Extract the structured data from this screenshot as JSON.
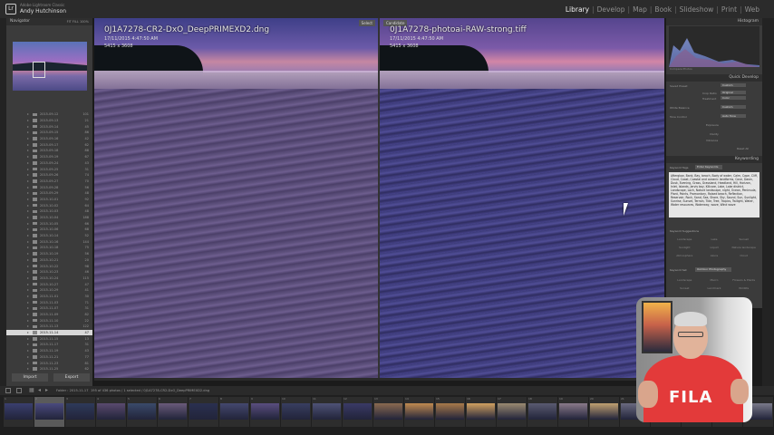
{
  "identity": {
    "sub": "Adobe Lightroom Classic",
    "name": "Andy Hutchinson"
  },
  "modules": [
    "Library",
    "Develop",
    "Map",
    "Book",
    "Slideshow",
    "Print",
    "Web"
  ],
  "active_module": "Library",
  "navigator": {
    "title": "Navigator",
    "zoom": "FIT   FILL   100%"
  },
  "folders": [
    {
      "name": "2015-09-12",
      "count": "101"
    },
    {
      "name": "2015-09-13",
      "count": "21"
    },
    {
      "name": "2015-09-14",
      "count": "45"
    },
    {
      "name": "2015-09-15",
      "count": "86"
    },
    {
      "name": "2015-09-16",
      "count": "42"
    },
    {
      "name": "2015-09-17",
      "count": "62"
    },
    {
      "name": "2015-09-18",
      "count": "88"
    },
    {
      "name": "2015-09-19",
      "count": "67"
    },
    {
      "name": "2015-09-24",
      "count": "43"
    },
    {
      "name": "2015-09-25",
      "count": "31"
    },
    {
      "name": "2015-09-26",
      "count": "74"
    },
    {
      "name": "2015-09-27",
      "count": "70"
    },
    {
      "name": "2015-09-28",
      "count": "56"
    },
    {
      "name": "2015-09-29",
      "count": "48"
    },
    {
      "name": "2015-10-01",
      "count": "92"
    },
    {
      "name": "2015-10-02",
      "count": "64"
    },
    {
      "name": "2015-10-03",
      "count": "48"
    },
    {
      "name": "2015-10-04",
      "count": "188"
    },
    {
      "name": "2015-10-05",
      "count": "66"
    },
    {
      "name": "2015-10-06",
      "count": "68"
    },
    {
      "name": "2015-10-14",
      "count": "52"
    },
    {
      "name": "2015-10-16",
      "count": "144"
    },
    {
      "name": "2015-10-18",
      "count": "75"
    },
    {
      "name": "2015-10-19",
      "count": "56"
    },
    {
      "name": "2015-10-21",
      "count": "20"
    },
    {
      "name": "2015-10-22",
      "count": "98"
    },
    {
      "name": "2015-10-23",
      "count": "46"
    },
    {
      "name": "2015-10-24",
      "count": "115"
    },
    {
      "name": "2015-10-27",
      "count": "47"
    },
    {
      "name": "2015-10-29",
      "count": "41"
    },
    {
      "name": "2015-11-01",
      "count": "30"
    },
    {
      "name": "2015-11-03",
      "count": "71"
    },
    {
      "name": "2015-11-07",
      "count": "31"
    },
    {
      "name": "2015-11-09",
      "count": "82"
    },
    {
      "name": "2015-11-10",
      "count": "22"
    },
    {
      "name": "2015-11-13",
      "count": "122"
    },
    {
      "name": "2015-11-14",
      "count": "47"
    },
    {
      "name": "2015-11-15",
      "count": "13"
    },
    {
      "name": "2015-11-17",
      "count": "31"
    },
    {
      "name": "2015-11-19",
      "count": "43"
    },
    {
      "name": "2015-11-21",
      "count": "77"
    },
    {
      "name": "2015-11-23",
      "count": "81"
    },
    {
      "name": "2015-11-25",
      "count": "62"
    }
  ],
  "selected_folder_index": 36,
  "buttons": {
    "import": "Import",
    "export": "Export"
  },
  "compare": {
    "select": {
      "tag": "Select",
      "filename": "0J1A7278-CR2-DxO_DeepPRIMEXD2.dng",
      "date": "17/11/2015 4:47:50 AM",
      "dims": "5415 x 3608"
    },
    "candidate": {
      "tag": "Candidate",
      "filename": "0J1A7278-photoai-RAW-strong.tiff",
      "date": "17/11/2015 4:47:50 AM",
      "dims": "5415 x 3608"
    }
  },
  "histogram": {
    "title": "Histogram",
    "info": "Compare Photos"
  },
  "quick_develop": {
    "title": "Quick Develop",
    "saved_preset_label": "Saved Preset",
    "saved_preset_value": "Custom",
    "crop_ratio_label": "Crop Ratio",
    "crop_ratio_value": "Original",
    "treatment_label": "Treatment",
    "treatment_value": "Color",
    "white_balance_label": "White Balance",
    "white_balance_value": "Custom",
    "tone_control_label": "Tone Control",
    "tone_control_value": "Auto Tone",
    "exposure_label": "Exposure",
    "clarity_label": "Clarity",
    "vibrance_label": "Vibrance",
    "reset_label": "Reset All"
  },
  "keywording": {
    "title": "Keywording",
    "tags_label": "Keyword Tags",
    "tags_mode": "Enter Keywords",
    "keywords": "Afterglow, Bank, Bay, beach, Body of water, Calm, Cape, Cliff, Cloud, Coast, Coastal and oceanic landforms, Cove, Dawn, Dusk, Evening, Grass, Grassland, Headland, Hill, Horizon, Inlet, Islands, Jervis bay, Killcare, Lake, Lake district, Landscape, Loch, Nature landscape, night, Ocean, Peninsula, Plant, Points, Promontory, Raised beach, Reflection, Reservoir, Rock, Sand, Sea, Shore, Sky, Sound, Sun, Sunlight, Sunrise, Sunset, Terrain, Tide, Tree, Tropics, Twilight, Water, Water resources, Waterway, wave, Wind wave",
    "suggestions_label": "Keyword Suggestions",
    "suggestions": [
      "Landscape",
      "Lake",
      "Sunset",
      "Sunlight",
      "Liquid",
      "Nature landscape",
      "Atmosphere",
      "Azure",
      "Cloud"
    ],
    "set_label": "Keyword Set",
    "set_value": "Outdoor Photography",
    "set_items": [
      "Landscape",
      "Macro",
      "Flowers & Plants",
      "Sunset",
      "Landmark",
      "Wildlife"
    ]
  },
  "filmstrip": {
    "path": "Folder : 2015-11-17",
    "status": "195 of 436 photos / 1 selected / 0J1A7278-CR2-DxO_DeepPRIMEXD2.dng",
    "cells": [
      "1",
      "2",
      "3",
      "4",
      "5",
      "6",
      "7",
      "8",
      "9",
      "10",
      "11",
      "12",
      "13",
      "14",
      "15",
      "16",
      "17",
      "18",
      "19",
      "20",
      "21",
      "22",
      "23",
      "24",
      "25"
    ],
    "selected_index": 1
  },
  "colors": {
    "active_module": "#f1f1f1",
    "panel_bg": "#3b3b3b",
    "selected_folder": "#d8d8d8",
    "hoodie": "#e33a3a"
  },
  "webcam": {
    "shirt_logo": "FILA"
  }
}
